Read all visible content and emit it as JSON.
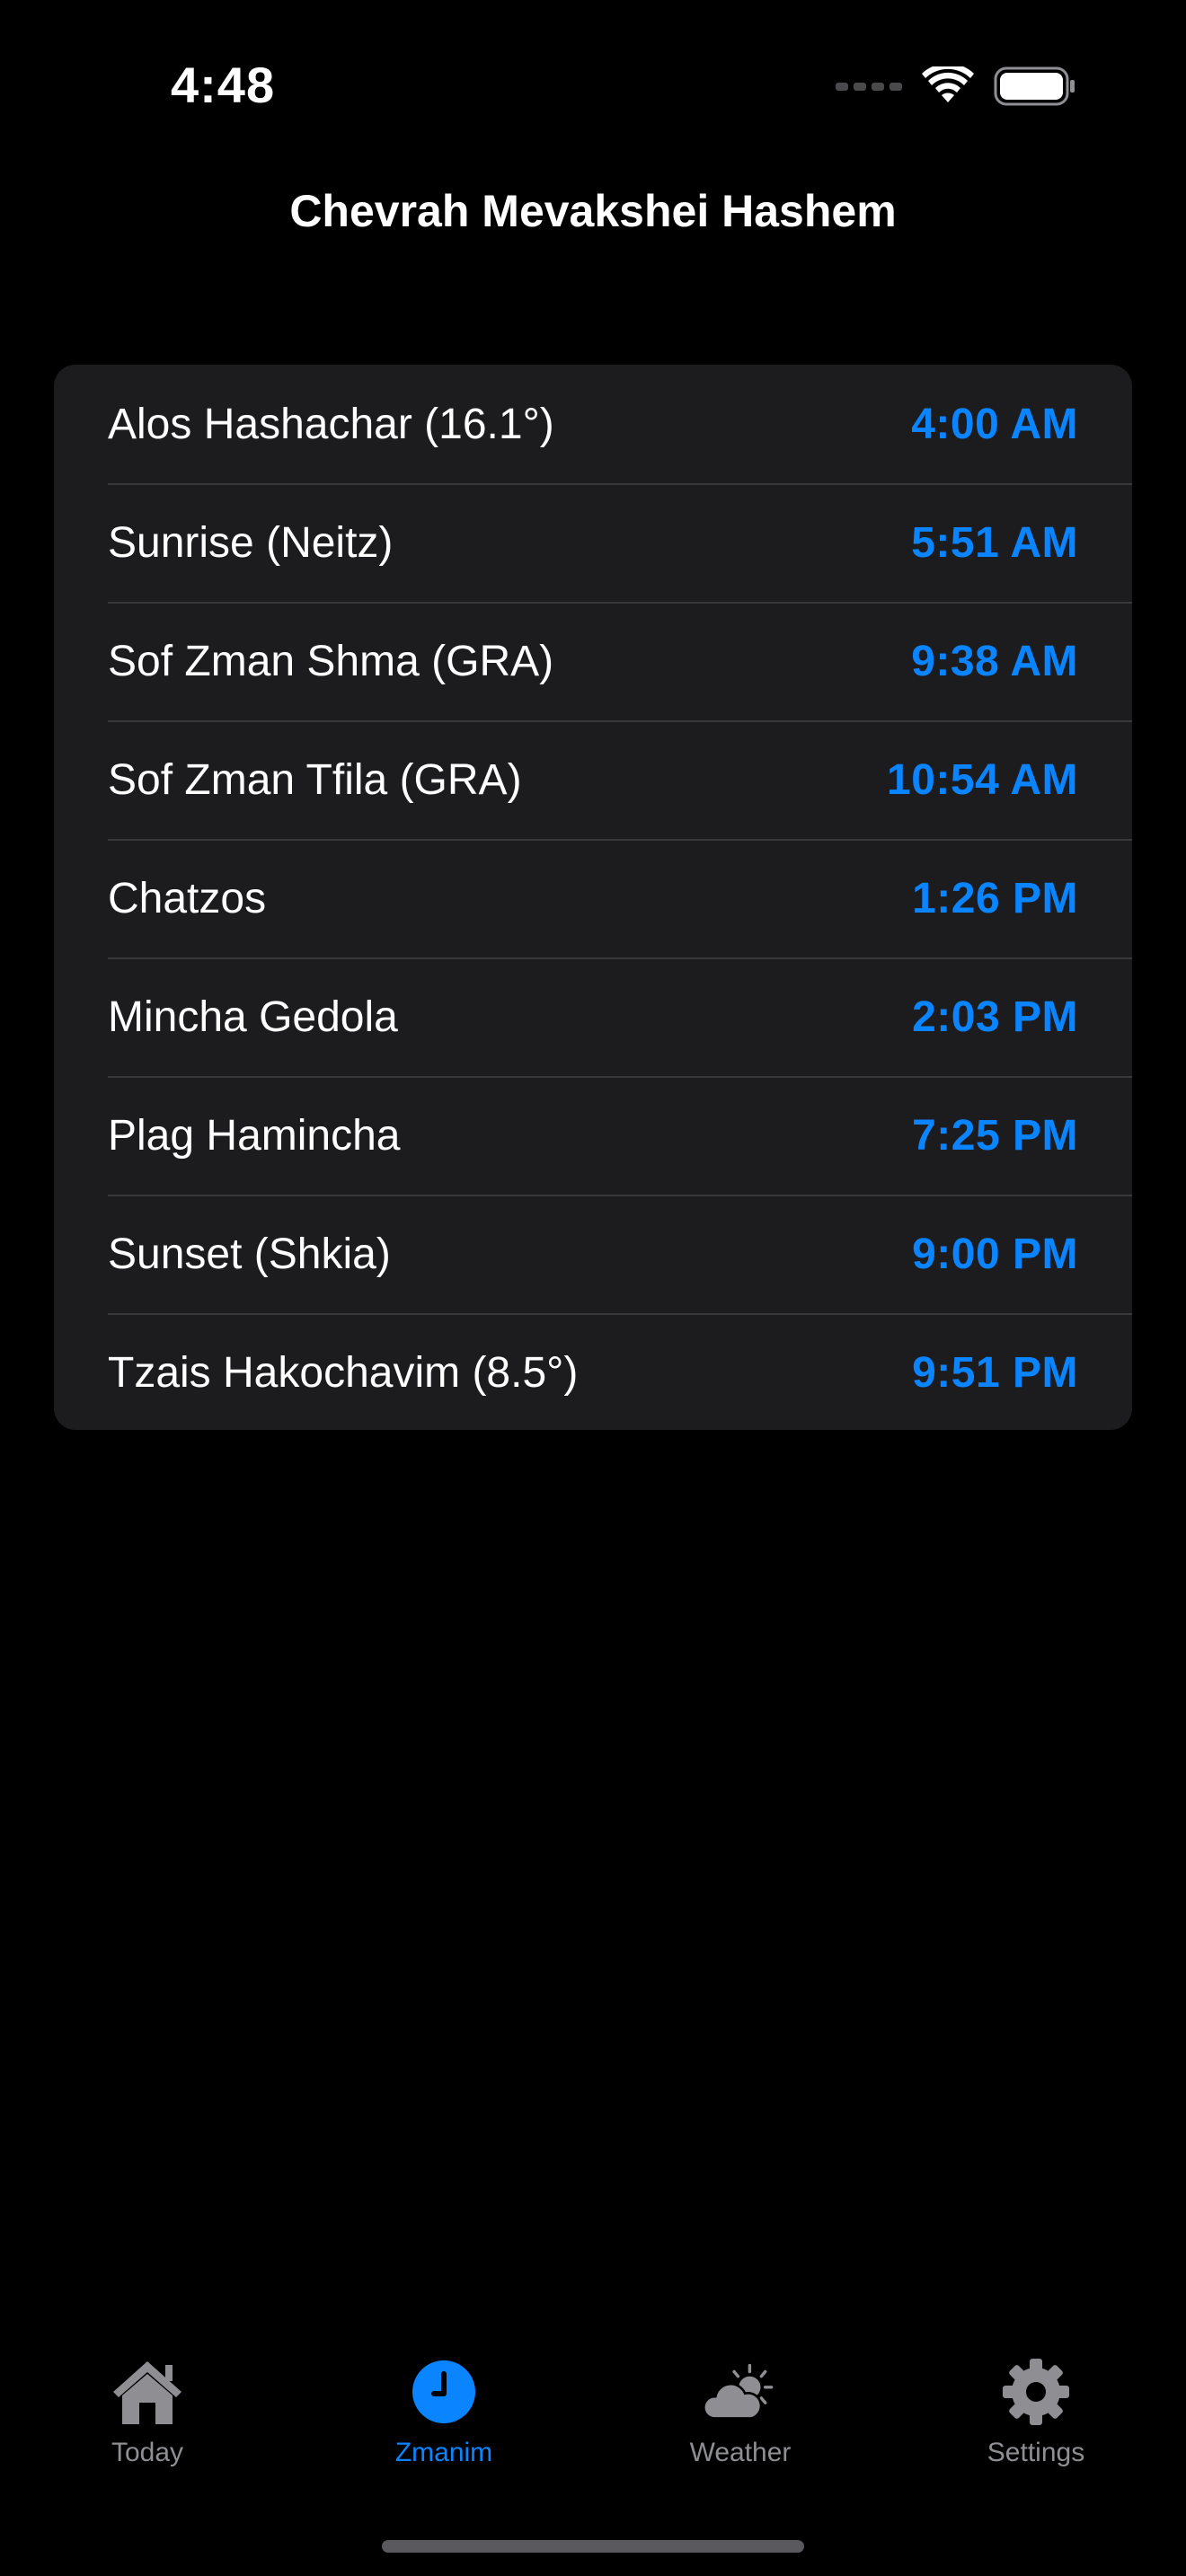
{
  "status_bar": {
    "time": "4:48"
  },
  "nav": {
    "title": "Chevrah Mevakshei Hashem"
  },
  "zmanim": [
    {
      "label": "Alos Hashachar (16.1°)",
      "time": "4:00 AM"
    },
    {
      "label": "Sunrise (Neitz)",
      "time": "5:51 AM"
    },
    {
      "label": "Sof Zman Shma (GRA)",
      "time": "9:38 AM"
    },
    {
      "label": "Sof Zman Tfila (GRA)",
      "time": "10:54 AM"
    },
    {
      "label": "Chatzos",
      "time": "1:26 PM"
    },
    {
      "label": "Mincha Gedola",
      "time": "2:03 PM"
    },
    {
      "label": "Plag Hamincha",
      "time": "7:25 PM"
    },
    {
      "label": "Sunset (Shkia)",
      "time": "9:00 PM"
    },
    {
      "label": "Tzais Hakochavim (8.5°)",
      "time": "9:51 PM"
    }
  ],
  "tabbar": {
    "items": [
      {
        "label": "Today",
        "icon": "house-icon",
        "active": false
      },
      {
        "label": "Zmanim",
        "icon": "clock-icon",
        "active": true
      },
      {
        "label": "Weather",
        "icon": "cloud-sun-icon",
        "active": false
      },
      {
        "label": "Settings",
        "icon": "gear-icon",
        "active": false
      }
    ]
  },
  "colors": {
    "background": "#000000",
    "card": "#1c1c1e",
    "accent": "#0a84ff",
    "inactive": "#8e8e93"
  }
}
